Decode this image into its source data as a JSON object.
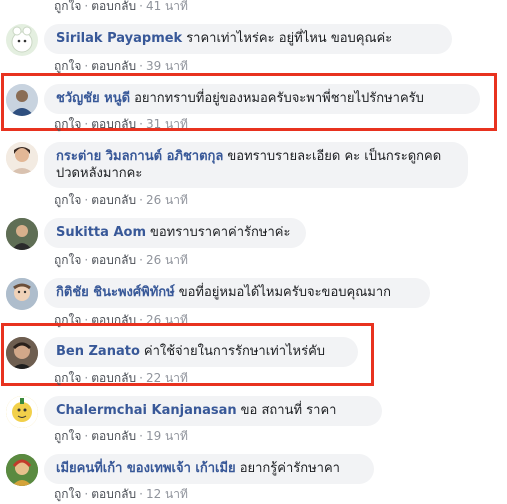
{
  "comments": [
    {
      "author": "",
      "text": "",
      "actions": {
        "like": "ถูกใจ",
        "reply": "ตอบกลับ",
        "time": "41 นาที"
      },
      "avatar_color": "#ffffff"
    },
    {
      "author": "Sirilak Payapmek",
      "text": "ราคาเท่าไหร่คะ อยู่ที่ไหน ขอบคุณค่ะ",
      "actions": {
        "like": "ถูกใจ",
        "reply": "ตอบกลับ",
        "time": "39 นาที"
      },
      "avatar_color": "#d9e6d2"
    },
    {
      "author": "ชวัญชัย หนูดี",
      "text": "อยากทราบที่อยู่ของหมอครับจะพาพี่ชายไปรักษาครับ",
      "actions": {
        "like": "ถูกใจ",
        "reply": "ตอบกลับ",
        "time": "31 นาที"
      },
      "avatar_color": "#3f5f8a"
    },
    {
      "author": "กระต่าย วิมลกานต์ อภิชาตกุล",
      "text": "ขอทราบรายละเอียด คะ เป็นกระดูกคด ปวดหลังมากคะ",
      "actions": {
        "like": "ถูกใจ",
        "reply": "ตอบกลับ",
        "time": "26 นาที"
      },
      "avatar_color": "#c9a98f"
    },
    {
      "author": "Sukitta Aom",
      "text": "ขอทราบราคาค่ารักษาค่ะ",
      "actions": {
        "like": "ถูกใจ",
        "reply": "ตอบกลับ",
        "time": "26 นาที"
      },
      "avatar_color": "#6b7a5e"
    },
    {
      "author": "กิติชัย ชินะพงศ์พิทักษ์",
      "text": "ขอที่อยู่หมอได้ไหมครับจะขอบคุณมาก",
      "actions": {
        "like": "ถูกใจ",
        "reply": "ตอบกลับ",
        "time": "26 นาที"
      },
      "avatar_color": "#b9c7d6"
    },
    {
      "author": "Ben Zanato",
      "text": "ค่าใช้จ่ายในการรักษาเท่าไหร่คับ",
      "actions": {
        "like": "ถูกใจ",
        "reply": "ตอบกลับ",
        "time": "22 นาที"
      },
      "avatar_color": "#7a6a5c"
    },
    {
      "author": "Chalermchai Kanjanasan",
      "text": "ขอ สถานที่ ราคา",
      "actions": {
        "like": "ถูกใจ",
        "reply": "ตอบกลับ",
        "time": "19 นาที"
      },
      "avatar_color": "#e8c23a"
    },
    {
      "author": "เมียคนที่เก้า ของเทพเจ้า เก้าเมีย",
      "text": "อยากรู้ค่ารักษาคา",
      "actions": {
        "like": "ถูกใจ",
        "reply": "ตอบกลับ",
        "time": "12 นาที"
      },
      "avatar_color": "#4c7a3a"
    }
  ],
  "highlight_color": "#e8321f"
}
